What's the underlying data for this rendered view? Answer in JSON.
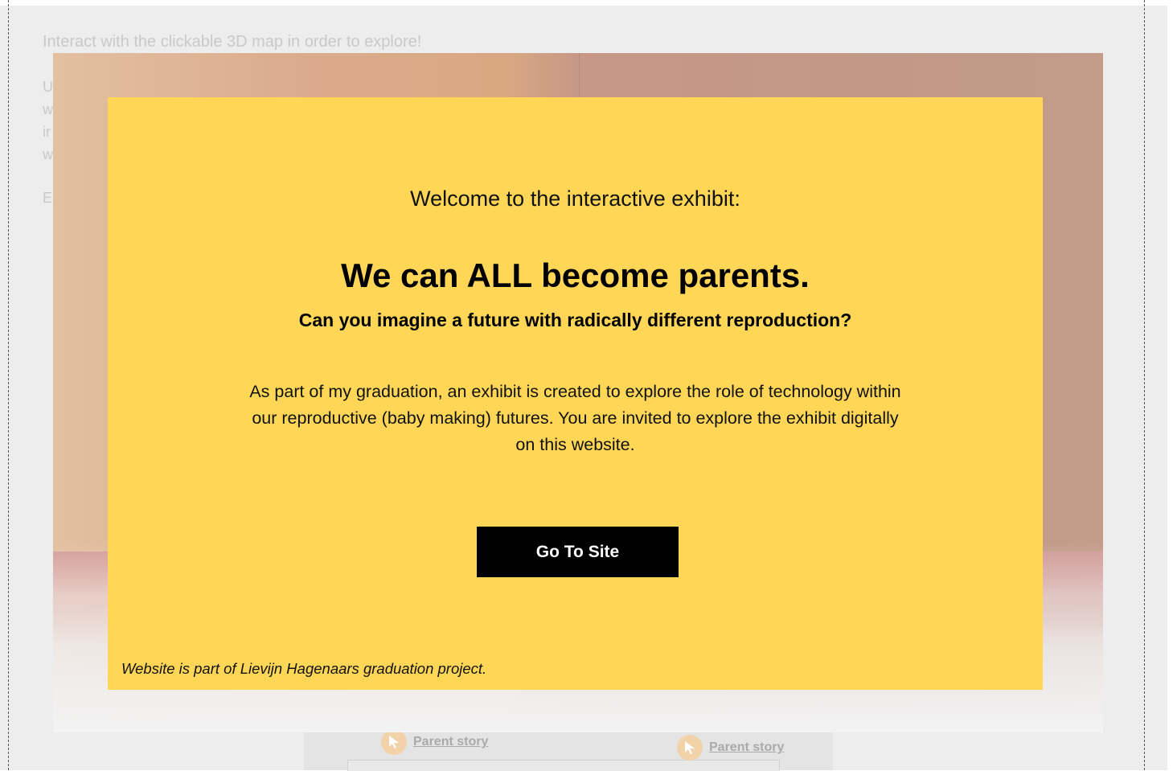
{
  "background": {
    "intro_text": "Interact with the clickable 3D map in order to explore!",
    "letter_fragments": [
      "U",
      "w",
      "ir",
      "w",
      "E"
    ],
    "story_links": [
      {
        "label": "Parent story",
        "icon": "cursor-icon"
      },
      {
        "label": "Parent story",
        "icon": "cursor-icon"
      }
    ]
  },
  "modal": {
    "welcome": "Welcome to the interactive exhibit:",
    "headline": "We can ALL become parents.",
    "subheadline": "Can you imagine a future with radically different reproduction?",
    "paragraph": "As part of my graduation, an exhibit is created to explore the role of technology within our reproductive (baby making) futures. You are invited to explore the exhibit digitally on this website.",
    "button_label": "Go To Site",
    "footer_note": "Website is part of  Lievijn Hagenaars graduation project."
  },
  "colors": {
    "modal_background": "#ffd655",
    "button_background": "#000000",
    "button_text": "#ffffff",
    "page_background": "#ededed"
  }
}
